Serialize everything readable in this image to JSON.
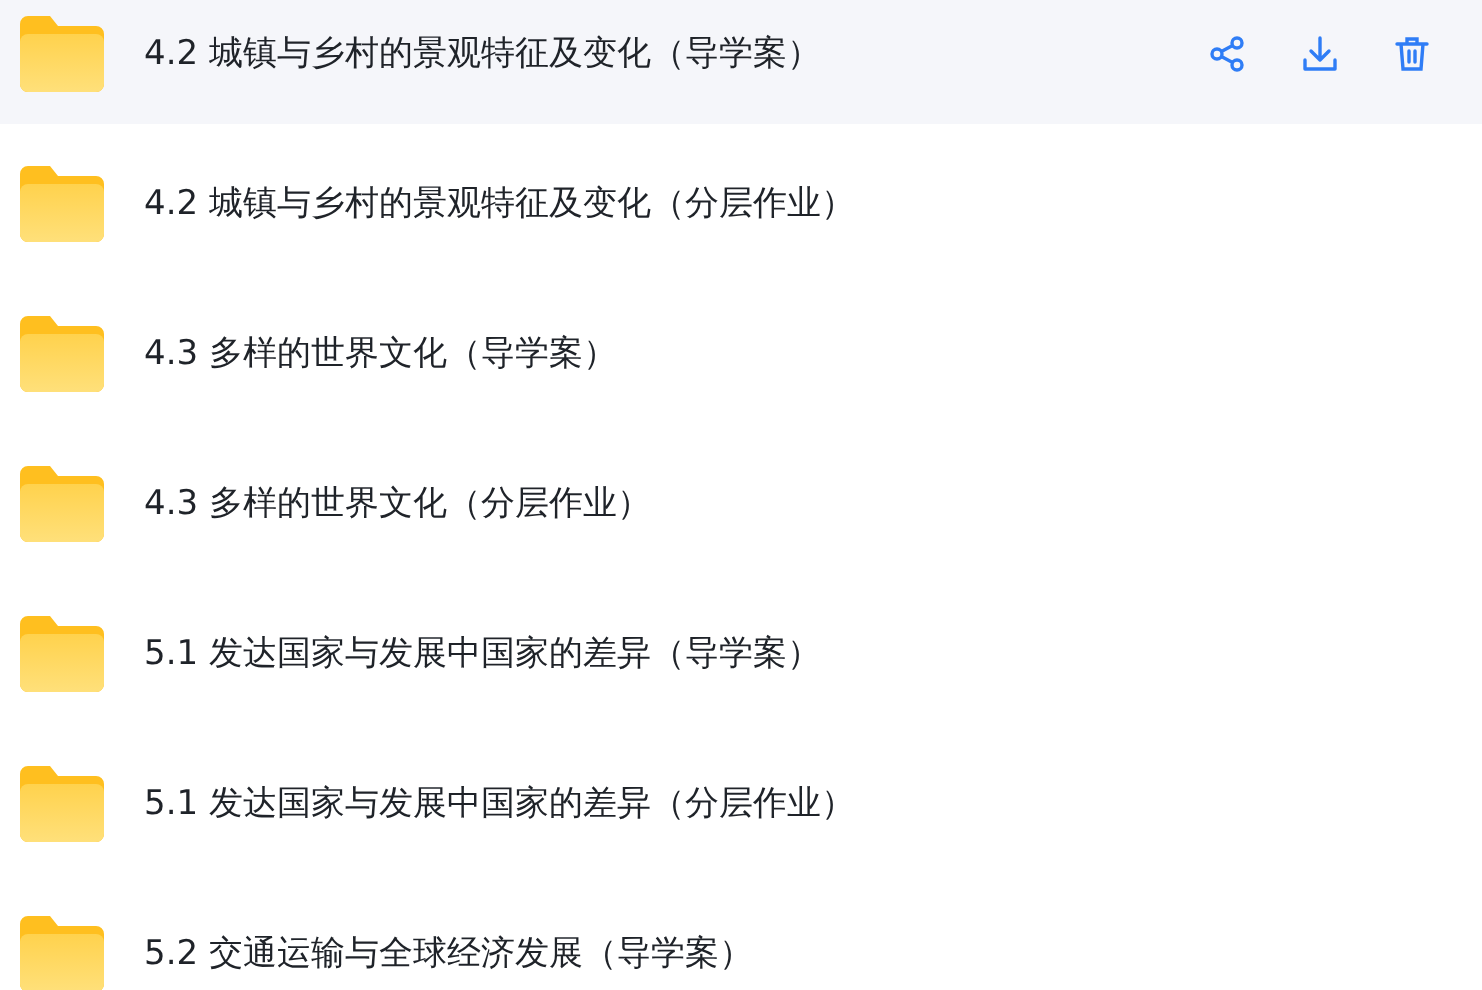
{
  "files": [
    {
      "name": "4.2 城镇与乡村的景观特征及变化（导学案）",
      "selected": true
    },
    {
      "name": "4.2 城镇与乡村的景观特征及变化（分层作业）",
      "selected": false
    },
    {
      "name": "4.3 多样的世界文化（导学案）",
      "selected": false
    },
    {
      "name": "4.3 多样的世界文化（分层作业）",
      "selected": false
    },
    {
      "name": "5.1 发达国家与发展中国家的差异（导学案）",
      "selected": false
    },
    {
      "name": "5.1 发达国家与发展中国家的差异（分层作业）",
      "selected": false
    },
    {
      "name": "5.2 交通运输与全球经济发展（导学案）",
      "selected": false
    }
  ]
}
